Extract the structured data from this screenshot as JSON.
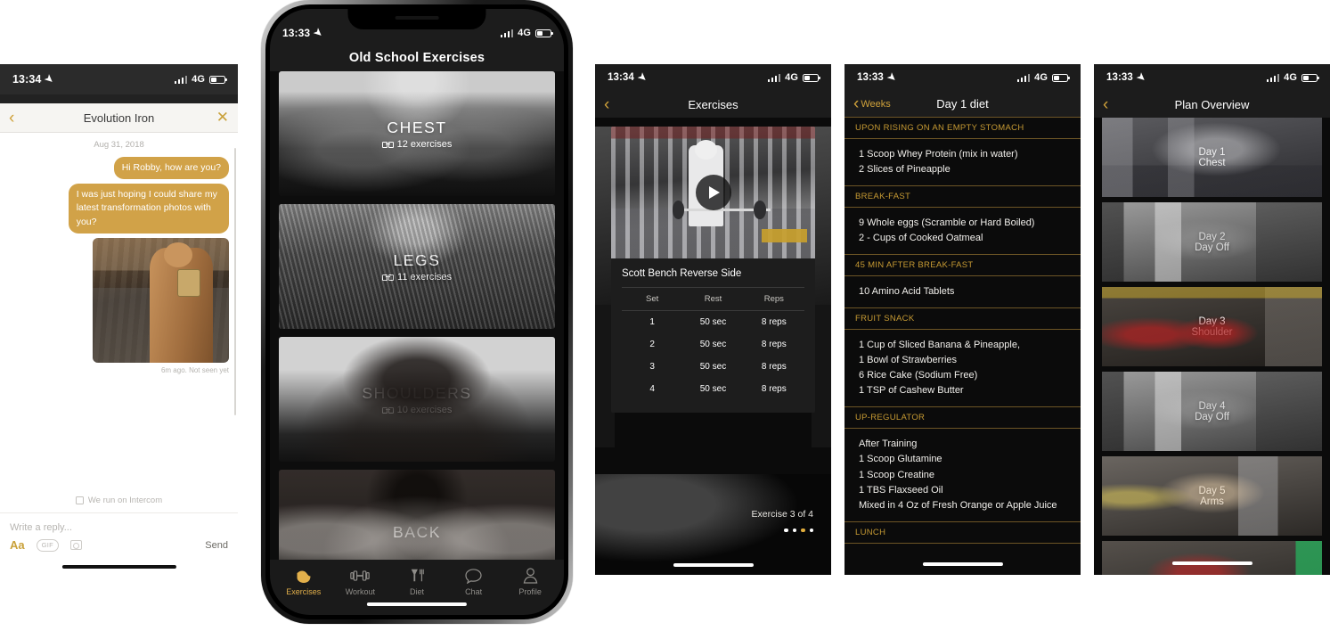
{
  "phone1": {
    "status": {
      "time": "13:34",
      "network": "4G"
    },
    "nav": {
      "title": "Evolution Iron",
      "back_icon": "chevron-left-icon",
      "close_icon": "close-icon"
    },
    "chat": {
      "date": "Aug 31, 2018",
      "messages": [
        "Hi Robby, how are you?",
        "I was just hoping I could share my latest transformation photos with you?"
      ],
      "photo_alt": "transformation-photo",
      "meta": "6m ago. Not seen yet"
    },
    "footer": {
      "branding": "We run on Intercom",
      "input_placeholder": "Write a reply...",
      "tool_format": "Aa",
      "tool_gif": "GIF",
      "tool_image": "image-icon",
      "send": "Send"
    }
  },
  "phone2": {
    "status": {
      "time": "13:33",
      "network": "4G"
    },
    "nav": {
      "title": "Old School Exercises"
    },
    "cards": [
      {
        "name": "CHEST",
        "count": "12 exercises",
        "bg": "bg-chest"
      },
      {
        "name": "LEGS",
        "count": "11 exercises",
        "bg": "bg-legs"
      },
      {
        "name": "SHOULDERS",
        "count": "10 exercises",
        "bg": "bg-shoulders"
      },
      {
        "name": "BACK",
        "count": "",
        "bg": "bg-back"
      }
    ],
    "tabs": [
      {
        "label": "Exercises",
        "icon": "bicep-icon",
        "active": true
      },
      {
        "label": "Workout",
        "icon": "dumbbell-icon",
        "active": false
      },
      {
        "label": "Diet",
        "icon": "fork-and-glass-icon",
        "active": false
      },
      {
        "label": "Chat",
        "icon": "speech-bubble-icon",
        "active": false
      },
      {
        "label": "Profile",
        "icon": "person-icon",
        "active": false
      }
    ]
  },
  "phone3": {
    "status": {
      "time": "13:34",
      "network": "4G"
    },
    "nav": {
      "title": "Exercises",
      "back_icon": "chevron-left-icon"
    },
    "exercise": {
      "title": "Scott Bench Reverse Side",
      "play_icon": "play-icon",
      "table": {
        "headers": [
          "Set",
          "Rest",
          "Reps"
        ],
        "rows": [
          [
            "1",
            "50 sec",
            "8 reps"
          ],
          [
            "2",
            "50 sec",
            "8 reps"
          ],
          [
            "3",
            "50 sec",
            "8 reps"
          ],
          [
            "4",
            "50 sec",
            "8 reps"
          ]
        ]
      },
      "counter": "Exercise 3 of 4",
      "page_dots": 4,
      "page_active": 3
    }
  },
  "phone4": {
    "status": {
      "time": "13:33",
      "network": "4G"
    },
    "nav": {
      "back_label": "Weeks",
      "title": "Day 1 diet",
      "back_icon": "chevron-left-icon"
    },
    "sections": [
      {
        "header": "UPON RISING ON AN EMPTY STOMACH",
        "items": [
          "1 Scoop Whey Protein (mix in water)",
          "2 Slices of Pineapple"
        ]
      },
      {
        "header": "BREAK-FAST",
        "items": [
          "9 Whole eggs (Scramble or Hard Boiled)",
          "2 - Cups of Cooked Oatmeal"
        ]
      },
      {
        "header": "45 MIN AFTER BREAK-FAST",
        "items": [
          "10 Amino Acid Tablets"
        ]
      },
      {
        "header": "FRUIT SNACK",
        "items": [
          "1 Cup of Sliced Banana & Pineapple,",
          "1 Bowl of Strawberries",
          "6 Rice Cake (Sodium Free)",
          "1 TSP of Cashew Butter"
        ]
      },
      {
        "header": "UP-REGULATOR",
        "items": [
          "After Training",
          "1 Scoop Glutamine",
          "1 Scoop Creatine",
          "1 TBS Flaxseed Oil",
          "Mixed in 4 Oz of Fresh Orange or Apple Juice"
        ]
      },
      {
        "header": "LUNCH",
        "items": []
      }
    ]
  },
  "phone5": {
    "status": {
      "time": "13:33",
      "network": "4G"
    },
    "nav": {
      "title": "Plan Overview",
      "back_icon": "chevron-left-icon"
    },
    "days": [
      {
        "day": "Day 1",
        "focus": "Chest",
        "bg": "bg-g1"
      },
      {
        "day": "Day 2",
        "focus": "Day Off",
        "bg": "bg-g2"
      },
      {
        "day": "Day 3",
        "focus": "Shoulder",
        "bg": "bg-g3"
      },
      {
        "day": "Day 4",
        "focus": "Day Off",
        "bg": "bg-g4"
      },
      {
        "day": "Day 5",
        "focus": "Arms",
        "bg": "bg-g5"
      },
      {
        "day": "",
        "focus": "",
        "bg": "bg-g6"
      }
    ]
  },
  "colors": {
    "gold": "#cfa13a",
    "bubble_gold": "#d1a248",
    "dark_bg": "#0d0d0d",
    "nav_bg": "#1c1c1c",
    "divider_gold": "#6d5526"
  }
}
